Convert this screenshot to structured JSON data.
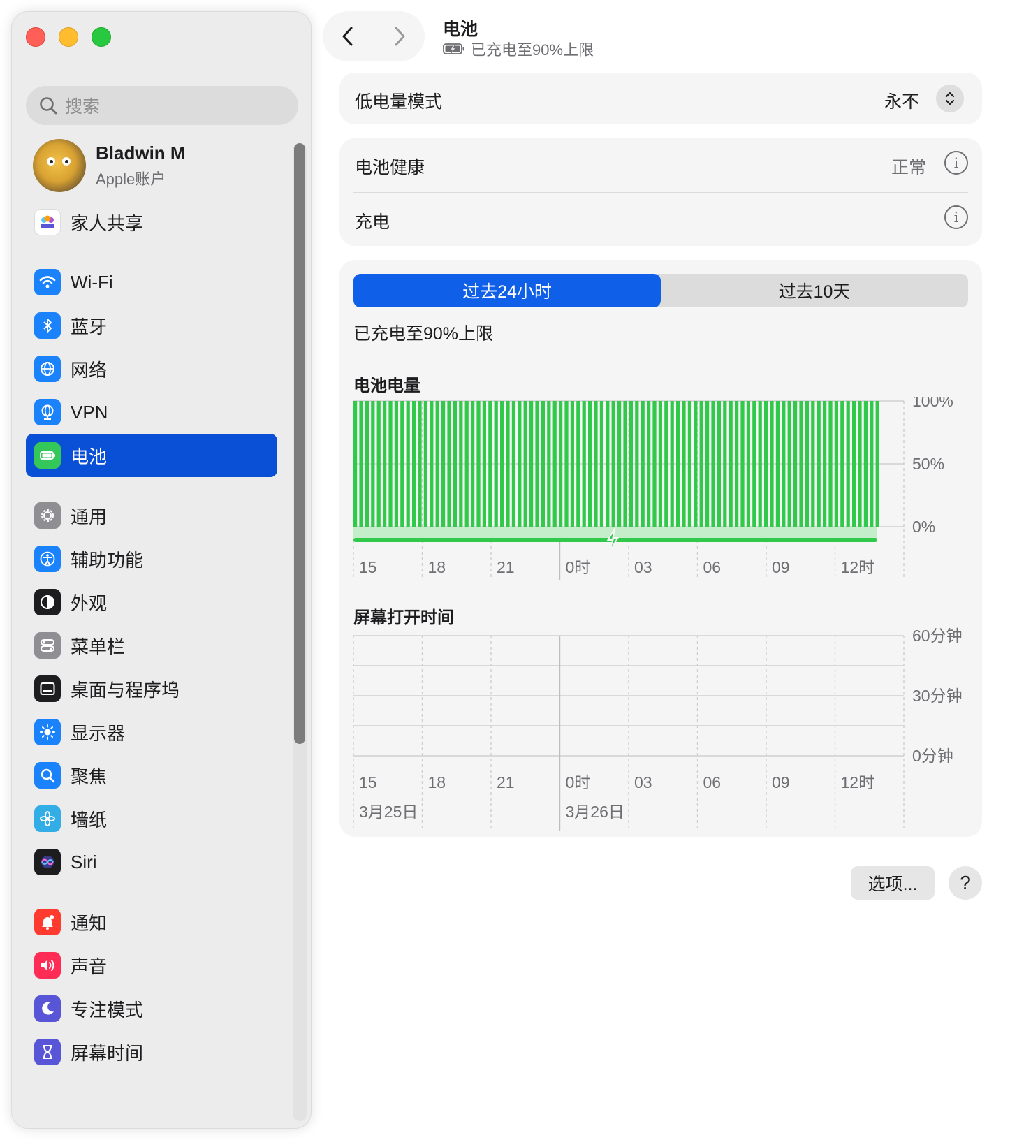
{
  "window": {
    "title": "电池",
    "subtitle": "已充电至90%上限"
  },
  "sidebar": {
    "search_placeholder": "搜索",
    "account": {
      "name": "Bladwin M",
      "subtitle": "Apple账户"
    },
    "items": [
      {
        "label": "家人共享",
        "icon": "family-icon",
        "color": "#ffffff"
      },
      {
        "label": "Wi-Fi",
        "icon": "wifi-icon",
        "color": "#1a82fb"
      },
      {
        "label": "蓝牙",
        "icon": "bluetooth-icon",
        "color": "#1a82fb"
      },
      {
        "label": "网络",
        "icon": "globe-icon",
        "color": "#1a82fb"
      },
      {
        "label": "VPN",
        "icon": "vpn-icon",
        "color": "#1a82fb"
      },
      {
        "label": "电池",
        "icon": "battery-icon",
        "color": "#34c759",
        "selected": true
      },
      {
        "label": "通用",
        "icon": "gear-icon",
        "color": "#8e8e93"
      },
      {
        "label": "辅助功能",
        "icon": "accessibility-icon",
        "color": "#1a82fb"
      },
      {
        "label": "外观",
        "icon": "appearance-icon",
        "color": "#1d1d1f"
      },
      {
        "label": "菜单栏",
        "icon": "menubar-icon",
        "color": "#8e8e93"
      },
      {
        "label": "桌面与程序坞",
        "icon": "dock-icon",
        "color": "#1d1d1f"
      },
      {
        "label": "显示器",
        "icon": "display-icon",
        "color": "#1a82fb"
      },
      {
        "label": "聚焦",
        "icon": "spotlight-icon",
        "color": "#1a82fb"
      },
      {
        "label": "墙纸",
        "icon": "wallpaper-icon",
        "color": "#32ade6"
      },
      {
        "label": "Siri",
        "icon": "siri-icon",
        "color": "#1d1d1f"
      },
      {
        "label": "通知",
        "icon": "notification-icon",
        "color": "#ff3b30"
      },
      {
        "label": "声音",
        "icon": "sound-icon",
        "color": "#ff2d55"
      },
      {
        "label": "专注模式",
        "icon": "focus-icon",
        "color": "#5856d6"
      },
      {
        "label": "屏幕时间",
        "icon": "screentime-icon",
        "color": "#5856d6"
      }
    ]
  },
  "low_power": {
    "label": "低电量模式",
    "value": "永不"
  },
  "health": {
    "label": "电池健康",
    "value": "正常"
  },
  "charging": {
    "label": "充电"
  },
  "usage": {
    "tabs": [
      "过去24小时",
      "过去10天"
    ],
    "status": "已充电至90%上限"
  },
  "options_label": "选项...",
  "help_label": "?",
  "chart_data": [
    {
      "type": "bar",
      "title": "电池电量",
      "x_ticks": [
        "15",
        "18",
        "21",
        "0时",
        "03",
        "06",
        "09",
        "12时"
      ],
      "y_ticks": [
        "100%",
        "50%",
        "0%"
      ],
      "ylim": [
        0,
        100
      ],
      "values": [
        100,
        100,
        100,
        100,
        100,
        100,
        100,
        100,
        100,
        100,
        100,
        100,
        100,
        100,
        100,
        100,
        100,
        100,
        100,
        100,
        100,
        100,
        100,
        100,
        100,
        100,
        100,
        100,
        100,
        100,
        100,
        100,
        100,
        100,
        100,
        100,
        100,
        100,
        100,
        100,
        100,
        100,
        100,
        100,
        100,
        100,
        100,
        100,
        100,
        100,
        100,
        100,
        100,
        100,
        100,
        100,
        100,
        100,
        100,
        100,
        100,
        100,
        100,
        100,
        100,
        100,
        100,
        100,
        100,
        100,
        100,
        100,
        100,
        100,
        100,
        100,
        100,
        100,
        100,
        100,
        100,
        100,
        100,
        100,
        100,
        100,
        100,
        100,
        100,
        100
      ],
      "charging": true,
      "color": "#30c94a"
    },
    {
      "type": "bar",
      "title": "屏幕打开时间",
      "x_ticks": [
        "15",
        "18",
        "21",
        "0时",
        "03",
        "06",
        "09",
        "12时"
      ],
      "date_labels": [
        "3月25日",
        "3月26日"
      ],
      "y_ticks": [
        "60分钟",
        "30分钟",
        "0分钟"
      ],
      "ylim": [
        0,
        60
      ],
      "values": []
    }
  ]
}
